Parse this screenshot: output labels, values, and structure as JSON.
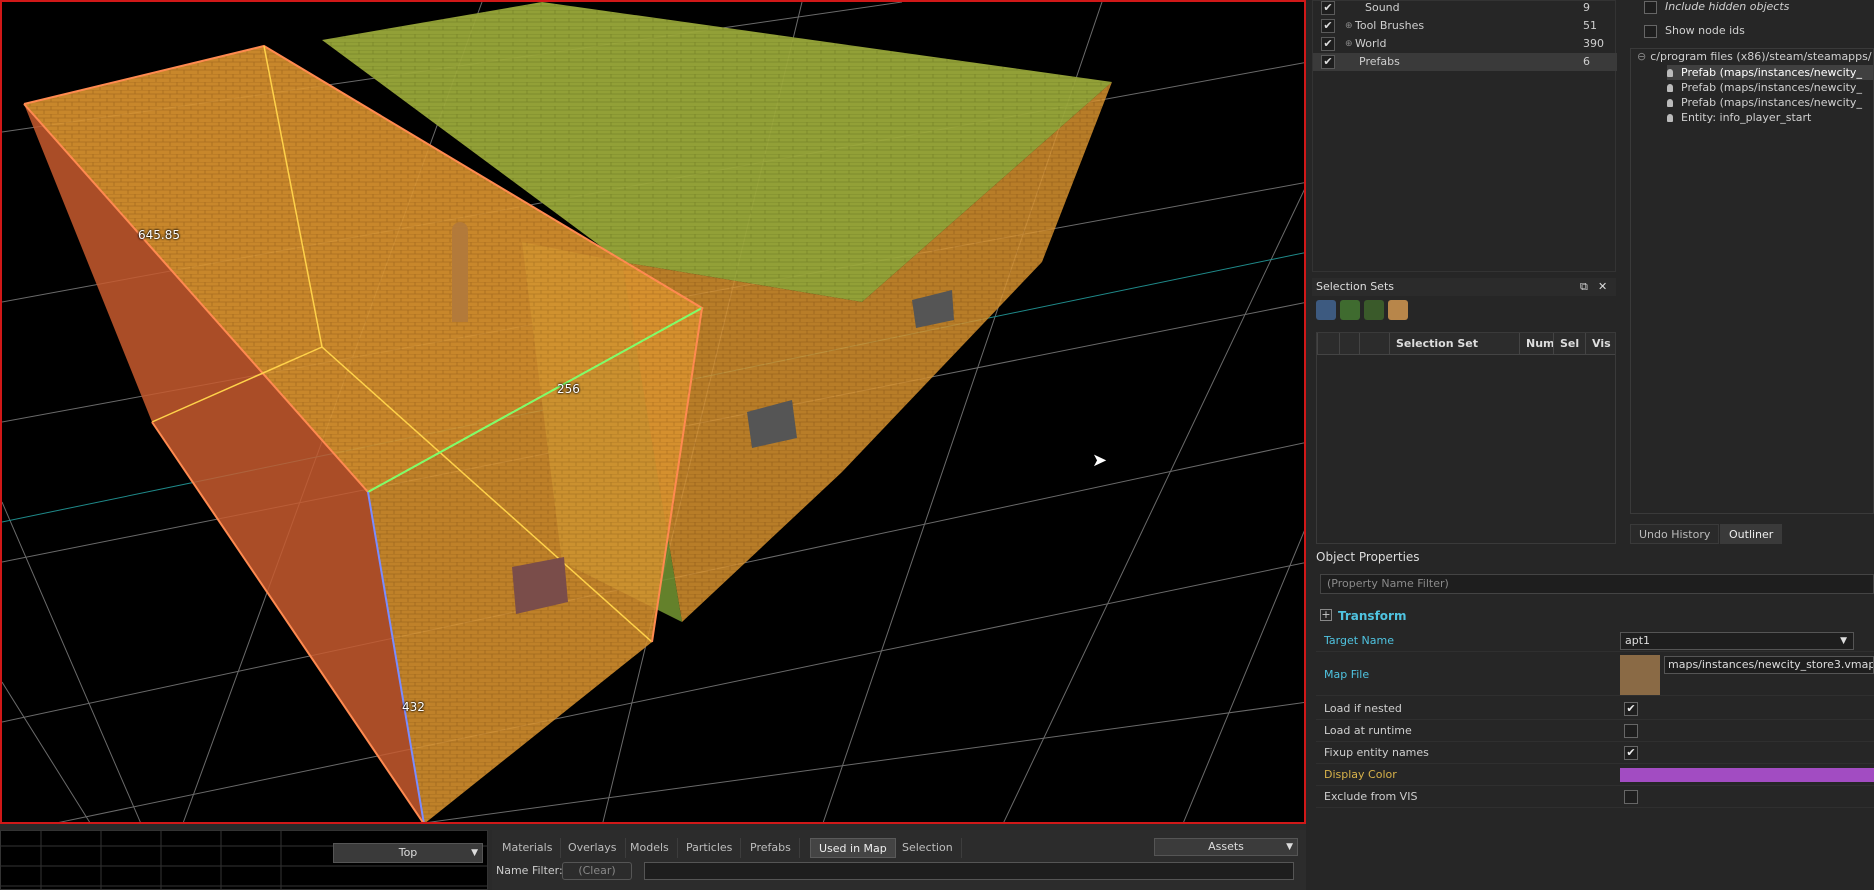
{
  "viewport": {
    "dimensions": {
      "length": "645.85",
      "width": "256",
      "height": "432"
    }
  },
  "minimap": {
    "view_mode": "Top"
  },
  "asset_browser": {
    "tabs": [
      "Materials",
      "Overlays",
      "Models",
      "Particles",
      "Prefabs",
      "Used in Map",
      "Selection"
    ],
    "active_tab": "Used in Map",
    "assets_button": "Assets",
    "name_filter_label": "Name Filter:",
    "clear_button": "(Clear)"
  },
  "layers": {
    "rows": [
      {
        "name": "Sound",
        "count": "9",
        "checked": "✔"
      },
      {
        "name": "Tool Brushes",
        "count": "51",
        "checked": "✔"
      },
      {
        "name": "World",
        "count": "390",
        "checked": "✔"
      },
      {
        "name": "Prefabs",
        "count": "6",
        "checked": "✔"
      }
    ]
  },
  "outliner": {
    "option_hidden": "Include hidden objects",
    "option_node_ids": "Show node ids",
    "root": "c/program files (x86)/steam/steamapps/",
    "children": [
      "Prefab (maps/instances/newcity_",
      "Prefab (maps/instances/newcity_",
      "Prefab (maps/instances/newcity_",
      "Entity: info_player_start"
    ],
    "tabs": [
      "Undo History",
      "Outliner"
    ],
    "active_tab": "Outliner"
  },
  "selection_sets": {
    "title": "Selection Sets",
    "columns": [
      "Selection Set",
      "Num",
      "Sel",
      "Vis"
    ],
    "header_controls": [
      "⧉",
      "✕"
    ]
  },
  "object_properties": {
    "title": "Object Properties",
    "filter_placeholder": "(Property Name Filter)",
    "section": "Transform",
    "section_toggle": "+",
    "target_name_label": "Target Name",
    "target_name_value": "apt1",
    "map_file_label": "Map File",
    "map_file_value": "maps/instances/newcity_store3.vmap",
    "load_if_nested": {
      "label": "Load if nested",
      "checked": "✔"
    },
    "load_at_runtime": {
      "label": "Load at runtime",
      "checked": ""
    },
    "fixup_entity_names": {
      "label": "Fixup entity names",
      "checked": "✔"
    },
    "display_color_label": "Display Color",
    "display_color_value": "#a24cc2",
    "exclude_from_vis": {
      "label": "Exclude from VIS",
      "checked": ""
    }
  }
}
